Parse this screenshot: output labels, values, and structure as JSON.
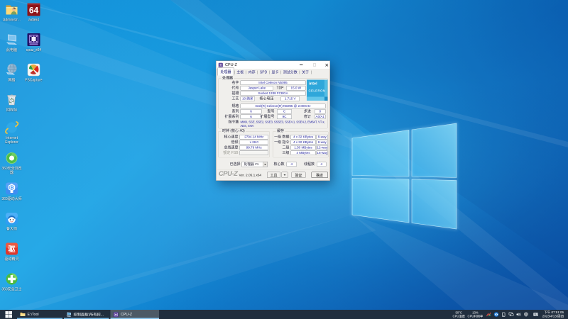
{
  "desktop": {
    "icons": [
      {
        "id": "administrator",
        "label": "Administr..."
      },
      {
        "id": "aida64",
        "label": "aida64",
        "badge": "64"
      },
      {
        "id": "this-pc",
        "label": "此电脑"
      },
      {
        "id": "cpuz-x64",
        "label": "cpuz_x64"
      },
      {
        "id": "network",
        "label": "网络"
      },
      {
        "id": "fscapture",
        "label": "FSCapture"
      },
      {
        "id": "recycle-bin",
        "label": "回收站"
      },
      {
        "id": "internet-explorer",
        "label": "Internet Explorer"
      },
      {
        "id": "360-browser",
        "label": "360安全浏览器"
      },
      {
        "id": "360-driver-master",
        "label": "360驱动大师"
      },
      {
        "id": "master-lu",
        "label": "鲁大师"
      },
      {
        "id": "driver-genius",
        "label": "驱动精灵",
        "glyph": "驱"
      },
      {
        "id": "360-safe-guard",
        "label": "360安全卫士"
      }
    ]
  },
  "cpuz": {
    "window_title": "CPU-Z",
    "tabs": [
      {
        "label": "处理器"
      },
      {
        "label": "主板"
      },
      {
        "label": "内存"
      },
      {
        "label": "SPD"
      },
      {
        "label": "显卡"
      },
      {
        "label": "测试分数"
      },
      {
        "label": "关于"
      }
    ],
    "processor": {
      "group_title": "处理器",
      "name_label": "名字",
      "name": "Intel Celeron N5095",
      "codename_label": "代号",
      "codename": "Jasper Lake",
      "tdp_label": "TDP",
      "tdp": "15.0 W",
      "package_label": "插槽",
      "package": "Socket 1338 FCBGA",
      "tech_label": "工艺",
      "tech": "10 纳米",
      "voltage_label": "核心电压",
      "voltage": "1.715 V",
      "spec_label": "规格",
      "spec": "Intel(R) Celeron(R) N5095 @ 2.00GHz",
      "family_label": "系列",
      "family": "6",
      "model_label": "型号",
      "model": "C",
      "stepping_label": "步进",
      "stepping": "0",
      "ext_family_label": "扩展系列",
      "ext_family": "6",
      "ext_model_label": "扩展型号",
      "ext_model": "9C",
      "revision_label": "修订",
      "revision": "A0/A1",
      "instructions_label": "指令集",
      "instructions_line1": "MMX, SSE, SSE2, SSE3, SSSE3, SSE4.1, SSE4.2, EM64T, VT-x,",
      "instructions_line2": "AES, SHA"
    },
    "badge": {
      "brand": "intel",
      "product": "CELERON"
    },
    "clocks": {
      "group_title": "时钟 (核心 #0)",
      "rows": [
        {
          "label": "核心速度",
          "value": "2794.14 MHz",
          "disabled": false
        },
        {
          "label": "倍频",
          "value": "x 28.0",
          "disabled": false
        },
        {
          "label": "总线速度",
          "value": "99.79 MHz",
          "disabled": false
        },
        {
          "label": "额定 FSB",
          "value": "",
          "disabled": true
        }
      ]
    },
    "cache": {
      "group_title": "缓存",
      "rows": [
        {
          "label": "一级 数据",
          "size": "4 x 32 KBytes",
          "assoc": "8-way"
        },
        {
          "label": "一级 指令",
          "size": "4 x 32 KBytes",
          "assoc": "8-way"
        },
        {
          "label": "二级",
          "size": "1.50 MBytes",
          "assoc": "12-way"
        },
        {
          "label": "三级",
          "size": "4 MBytes",
          "assoc": "16-way"
        }
      ]
    },
    "selection": {
      "label": "已选择",
      "combo_value": "处理器 #1",
      "cores_label": "核心数",
      "cores": "4",
      "threads_label": "线程数",
      "threads": "4"
    },
    "footer": {
      "logo": "CPU-Z",
      "version": "Ver. 2.05.1.x64",
      "tools_button": "工具",
      "validate_button": "验证",
      "ok_button": "确定"
    }
  },
  "taskbar": {
    "buttons": [
      {
        "id": "explorer-etool",
        "label": "E:\\Tool"
      },
      {
        "id": "control-panel",
        "label": "控制面板\\所有控..."
      },
      {
        "id": "cpuz-task",
        "label": "CPU-Z",
        "active": true
      }
    ],
    "tray": {
      "cpu_temp_value": "50°C",
      "cpu_temp_label": "CPU温度",
      "cpu_usage_value": "13%",
      "cpu_usage_label": "CPU利用率",
      "ime_indicator": "中",
      "time": "下午 07:51:06",
      "date": "2023/4/13/周四"
    }
  },
  "colors": {
    "accent_blue": "#0f83d4",
    "taskbar_bg": "#212e3e",
    "task_active_bg": "#4d5a66",
    "task_indicator": "#76b9e8",
    "cpuz_value_text": "#2626a0",
    "badge_bg": "#2fa7da"
  }
}
